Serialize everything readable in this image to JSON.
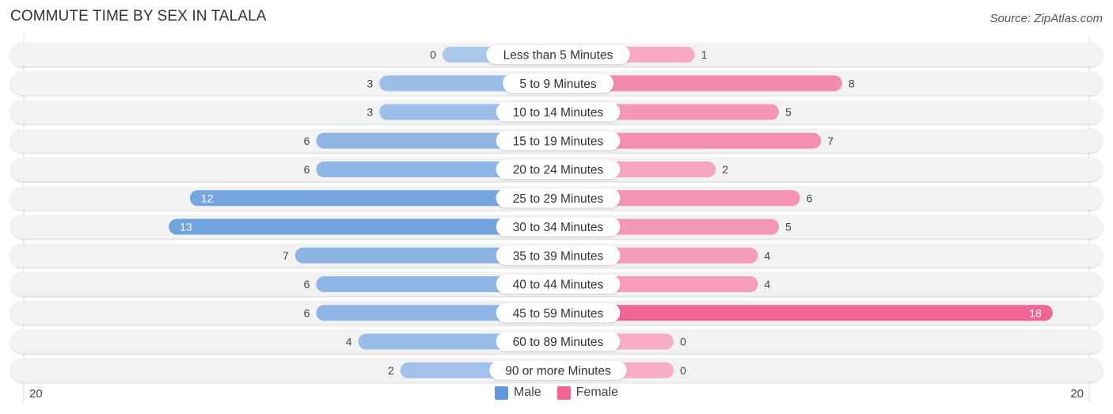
{
  "title": "COMMUTE TIME BY SEX IN TALALA",
  "source": "Source: ZipAtlas.com",
  "axis": {
    "left_label": "20",
    "right_label": "20"
  },
  "legend": [
    {
      "label": "Male",
      "color": "#6399dc"
    },
    {
      "label": "Female",
      "color": "#f06592"
    }
  ],
  "colors": {
    "male_light": "#a9c8ec",
    "male_dark": "#6399dc",
    "female_light": "#f7aec5",
    "female_dark": "#f06592",
    "row_bg": "#f2f2f2"
  },
  "chart_data": {
    "type": "bar",
    "orientation": "horizontal-diverging",
    "title": "COMMUTE TIME BY SEX IN TALALA",
    "categories": [
      "Less than 5 Minutes",
      "5 to 9 Minutes",
      "10 to 14 Minutes",
      "15 to 19 Minutes",
      "20 to 24 Minutes",
      "25 to 29 Minutes",
      "30 to 34 Minutes",
      "35 to 39 Minutes",
      "40 to 44 Minutes",
      "45 to 59 Minutes",
      "60 to 89 Minutes",
      "90 or more Minutes"
    ],
    "series": [
      {
        "name": "Male",
        "values": [
          0,
          3,
          3,
          6,
          6,
          12,
          13,
          7,
          6,
          6,
          4,
          2
        ]
      },
      {
        "name": "Female",
        "values": [
          1,
          8,
          5,
          7,
          2,
          6,
          5,
          4,
          4,
          18,
          0,
          0
        ]
      }
    ],
    "xlim": [
      -20,
      20
    ],
    "tick_labels": [
      "20",
      "20"
    ],
    "legend_position": "bottom-center",
    "grid": false
  }
}
